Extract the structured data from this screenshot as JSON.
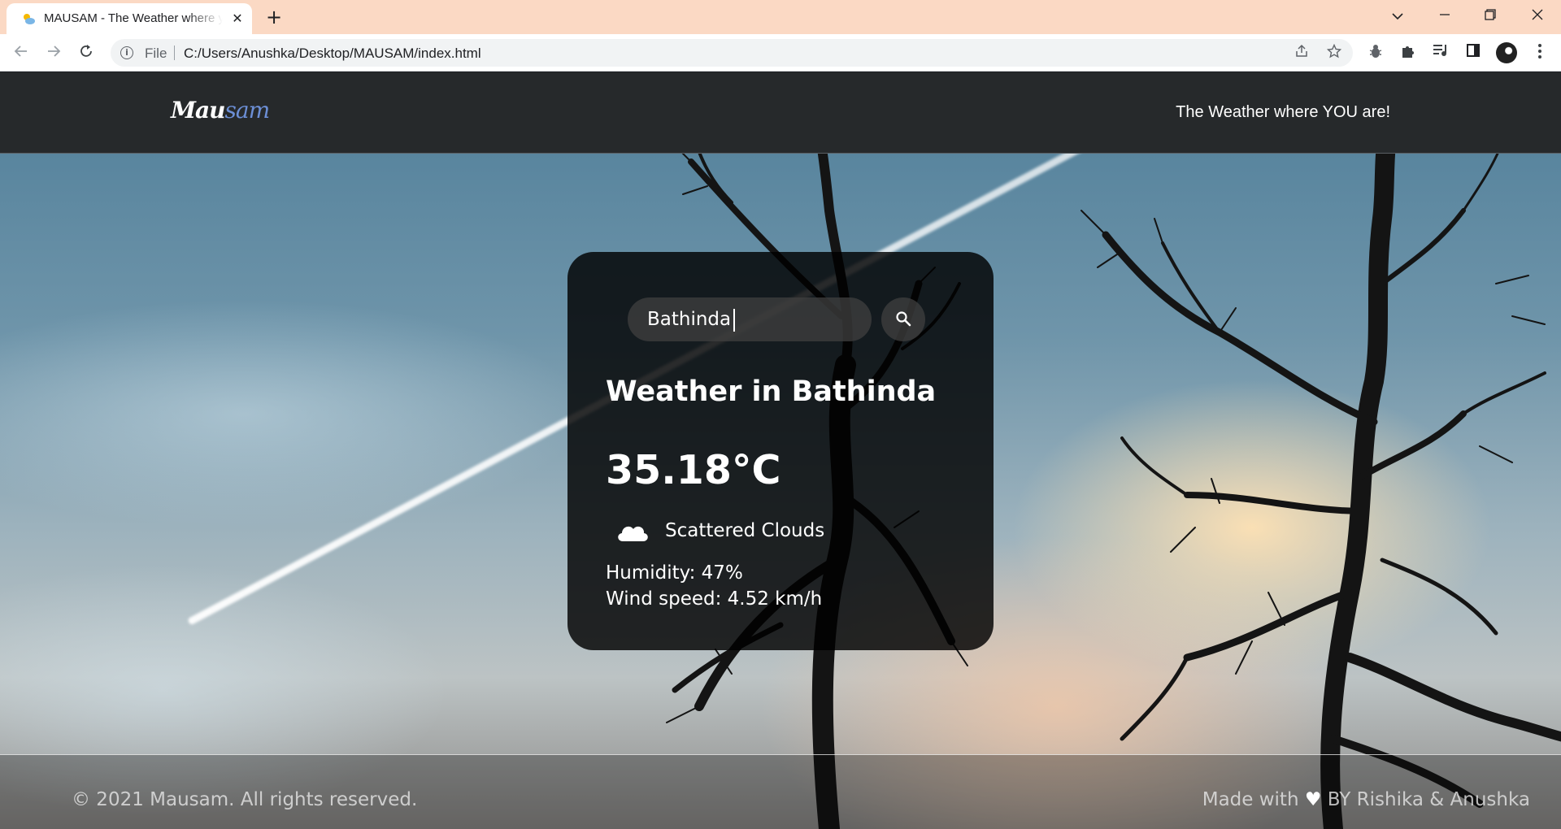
{
  "browser": {
    "tab_title": "MAUSAM - The Weather where you are",
    "tab_close": "✕",
    "new_tab": "+",
    "file_label": "File",
    "url": "C:/Users/Anushka/Desktop/MAUSAM/index.html"
  },
  "header": {
    "logo_main": "Mau",
    "logo_accent": "sam",
    "tagline": "The Weather where YOU are!"
  },
  "weather": {
    "search_value": "Bathinda",
    "search_icon": "search-icon",
    "title": "Weather in Bathinda",
    "temperature": "35.18°C",
    "condition_icon": "cloud-icon",
    "description": "Scattered Clouds",
    "humidity": "Humidity: 47%",
    "wind": "Wind speed: 4.52 km/h"
  },
  "footer": {
    "copyright": "© 2021 Mausam. All rights reserved.",
    "credits_prefix": "Made with ",
    "heart": "♥",
    "credits_suffix": " BY Rishika & Anushka"
  }
}
